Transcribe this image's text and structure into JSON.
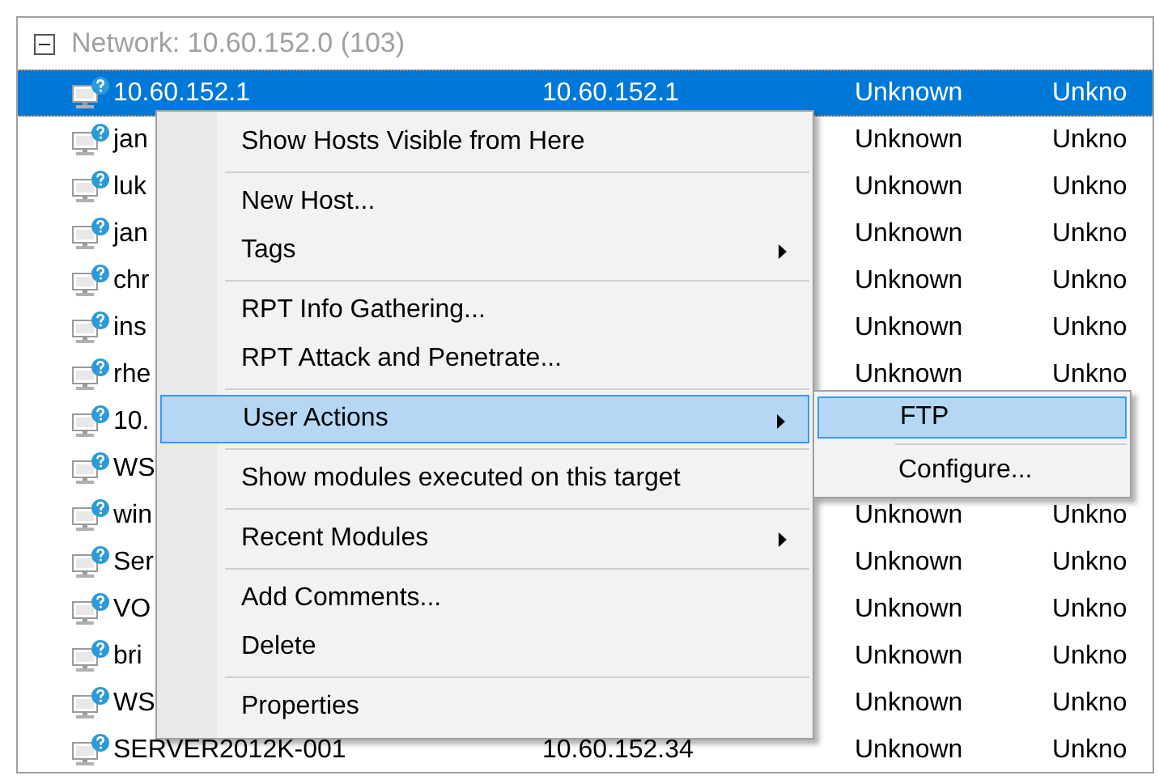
{
  "tree": {
    "title": "Network: 10.60.152.0 (103)",
    "expanded": true,
    "rows": [
      {
        "name": "10.60.152.1",
        "column_2": "10.60.152.1",
        "column_3": "Unknown",
        "column_4": "Unkno",
        "selected": true
      },
      {
        "name": "jan",
        "column_3": "Unknown",
        "column_4": "Unkno",
        "selected": false
      },
      {
        "name": "luk",
        "column_3": "Unknown",
        "column_4": "Unkno",
        "selected": false
      },
      {
        "name": "jan",
        "column_3": "Unknown",
        "column_4": "Unkno",
        "selected": false
      },
      {
        "name": "chr",
        "column_3": "Unknown",
        "column_4": "Unkno",
        "selected": false
      },
      {
        "name": "ins",
        "column_3": "Unknown",
        "column_4": "Unkno",
        "selected": false
      },
      {
        "name": "rhe",
        "column_3": "Unknown",
        "column_4": "Unkno",
        "selected": false
      },
      {
        "name": "10.",
        "selected": false
      },
      {
        "name": "WS",
        "selected": false
      },
      {
        "name": "win",
        "column_3": "Unknown",
        "column_4": "Unkno",
        "selected": false
      },
      {
        "name": "Ser",
        "column_3": "Unknown",
        "column_4": "Unkno",
        "selected": false
      },
      {
        "name": "VO",
        "column_3": "Unknown",
        "column_4": "Unkno",
        "selected": false
      },
      {
        "name": "bri",
        "column_3": "Unknown",
        "column_4": "Unkno",
        "selected": false
      },
      {
        "name": "WS",
        "column_3": "Unknown",
        "column_4": "Unkno",
        "selected": false
      },
      {
        "name": "SERVER2012K-001",
        "column_2": "10.60.152.34",
        "column_3": "Unknown",
        "column_4": "Unkno",
        "selected": false
      }
    ]
  },
  "context_menu": {
    "items": [
      {
        "kind": "item",
        "label": "Show Hosts Visible from Here",
        "submenu": false,
        "selected": false
      },
      {
        "kind": "separator"
      },
      {
        "kind": "item",
        "label": "New Host...",
        "submenu": false,
        "selected": false
      },
      {
        "kind": "item",
        "label": "Tags",
        "submenu": true,
        "selected": false
      },
      {
        "kind": "separator"
      },
      {
        "kind": "item",
        "label": "RPT Info Gathering...",
        "submenu": false,
        "selected": false
      },
      {
        "kind": "item",
        "label": "RPT Attack and Penetrate...",
        "submenu": false,
        "selected": false
      },
      {
        "kind": "separator"
      },
      {
        "kind": "item",
        "label": "User Actions",
        "submenu": true,
        "selected": true
      },
      {
        "kind": "separator"
      },
      {
        "kind": "item",
        "label": "Show modules executed on this target",
        "submenu": false,
        "selected": false
      },
      {
        "kind": "separator"
      },
      {
        "kind": "item",
        "label": "Recent Modules",
        "submenu": true,
        "selected": false
      },
      {
        "kind": "separator"
      },
      {
        "kind": "item",
        "label": "Add Comments...",
        "submenu": false,
        "selected": false
      },
      {
        "kind": "item",
        "label": "Delete",
        "submenu": false,
        "selected": false
      },
      {
        "kind": "separator"
      },
      {
        "kind": "item",
        "label": "Properties",
        "submenu": false,
        "selected": false
      }
    ]
  },
  "submenu": {
    "items": [
      {
        "kind": "item",
        "label": "FTP",
        "selected": true
      },
      {
        "kind": "separator"
      },
      {
        "kind": "item",
        "label": "Configure...",
        "selected": false
      }
    ]
  }
}
